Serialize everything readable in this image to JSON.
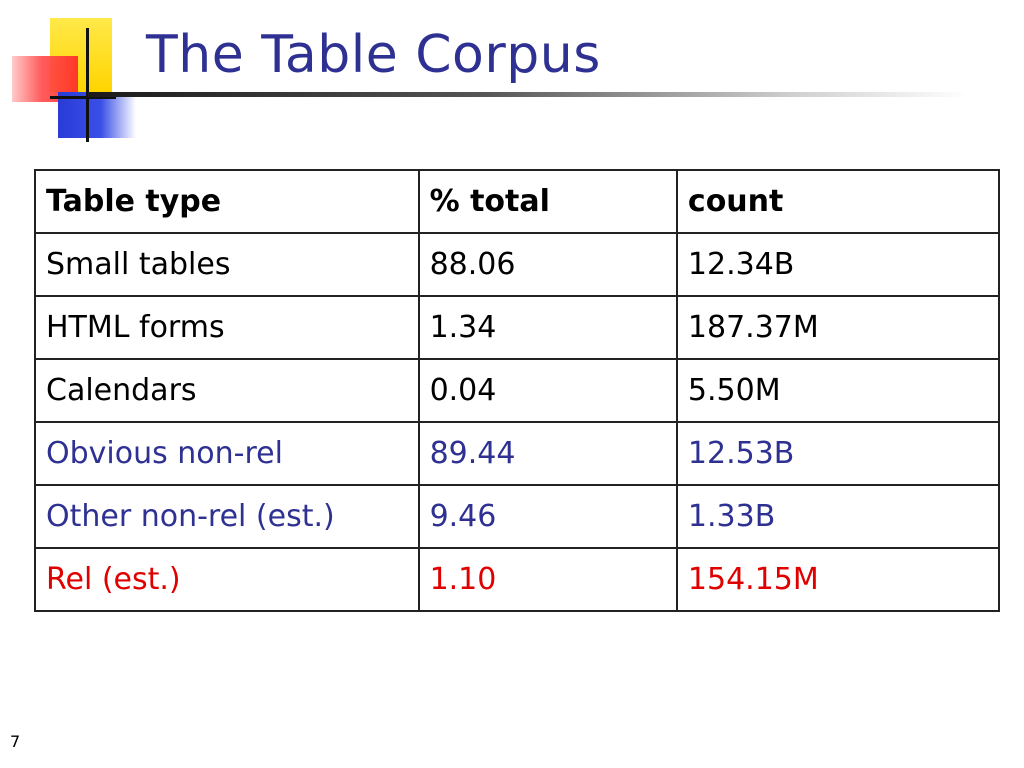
{
  "slide": {
    "title": "The Table Corpus",
    "page_number": "7"
  },
  "colors": {
    "title": "#2e3192",
    "blue_rows": "#2e3192",
    "red_rows": "#e00000",
    "logo_yellow": "#ffd400",
    "logo_red": "#ff2a2a",
    "logo_blue": "#2a3bd6"
  },
  "table": {
    "headers": [
      "Table type",
      "% total",
      "count"
    ],
    "rows": [
      {
        "type": "Small tables",
        "pct": "88.06",
        "count": "12.34B",
        "color": "black"
      },
      {
        "type": "HTML forms",
        "pct": "1.34",
        "count": "187.37M",
        "color": "black"
      },
      {
        "type": "Calendars",
        "pct": "0.04",
        "count": "5.50M",
        "color": "black"
      },
      {
        "type": "Obvious non-rel",
        "pct": "89.44",
        "count": "12.53B",
        "color": "blue"
      },
      {
        "type": "Other non-rel (est.)",
        "pct": "9.46",
        "count": "1.33B",
        "color": "blue"
      },
      {
        "type": "Rel (est.)",
        "pct": "1.10",
        "count": "154.15M",
        "color": "red"
      }
    ]
  }
}
